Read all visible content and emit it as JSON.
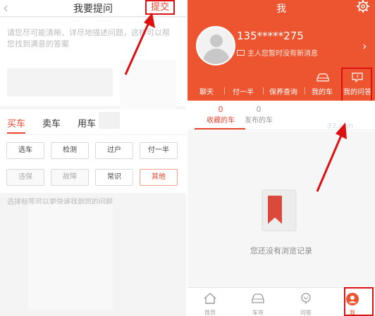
{
  "left": {
    "title": "我要提问",
    "submit_label": "提交",
    "question_placeholder": "请您尽可能清晰、详尽地描述问题，这样可以帮您找到满意的答案",
    "tabs": [
      "买车",
      "卖车",
      "用车"
    ],
    "tags_row1": [
      "选车",
      "检测",
      "过户",
      "付一半"
    ],
    "tags_row2": [
      "违保",
      "故障",
      "常识",
      "其他"
    ],
    "hint": "选择标签可以更快速找到您的问题"
  },
  "right": {
    "title": "我",
    "user_phone": "135*****275",
    "user_message": "主人您暂时没有新消息",
    "menu": [
      "聊天",
      "付一半",
      "保养查询",
      "我的车",
      "我的问答"
    ],
    "subtabs": [
      {
        "count": "0",
        "label": "收藏的车"
      },
      {
        "count": "0",
        "label": "发布的车"
      }
    ],
    "watermark": "33.com",
    "empty_text": "您还没有浏览记录",
    "bottom_nav": [
      "首页",
      "车市",
      "问答",
      "我"
    ]
  },
  "colors": {
    "accent": "#ec5530",
    "highlight_red": "#dd1111"
  }
}
